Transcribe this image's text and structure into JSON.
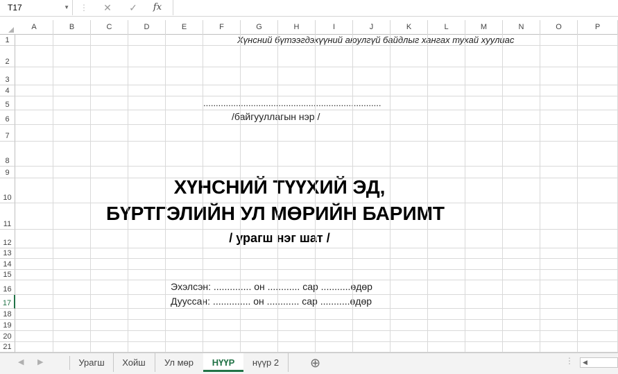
{
  "formula_bar": {
    "name_box": "T17",
    "cancel_icon": "✕",
    "enter_icon": "✓",
    "fx_label": "fx",
    "formula": ""
  },
  "columns": [
    "A",
    "B",
    "C",
    "D",
    "E",
    "F",
    "G",
    "H",
    "I",
    "J",
    "K",
    "L",
    "M",
    "N",
    "O",
    "P"
  ],
  "rows": [
    "1",
    "2",
    "3",
    "4",
    "5",
    "6",
    "7",
    "8",
    "9",
    "10",
    "11",
    "12",
    "13",
    "14",
    "15",
    "16",
    "17",
    "18",
    "19",
    "20",
    "21"
  ],
  "active_row": "17",
  "document": {
    "header_note": "Хүнсний бүтээгдэхүүний аюулгүй байдлыг хангах тухай хуулиас",
    "org_dots": ".......................................................................",
    "org_label": "/байгууллагын нэр /",
    "title_line1": "ХҮНСНИЙ ТҮҮХИЙ ЭД,",
    "title_line2": "БҮРТГЭЛИЙН УЛ МӨРИЙН БАРИМТ",
    "subtitle": "/ урагш нэг шат /",
    "started": "Эхэлсэн: .............. он ............ сар ...........өдөр",
    "finished": "Дууссан: .............. он ............ сар ...........өдөр"
  },
  "sheet_tabs": [
    {
      "label": "Урагш",
      "active": false
    },
    {
      "label": "Хойш",
      "active": false
    },
    {
      "label": "Ул мөр",
      "active": false
    },
    {
      "label": "НҮҮР",
      "active": true
    },
    {
      "label": "нүүр 2",
      "active": false
    }
  ],
  "add_sheet_icon": "⊕"
}
